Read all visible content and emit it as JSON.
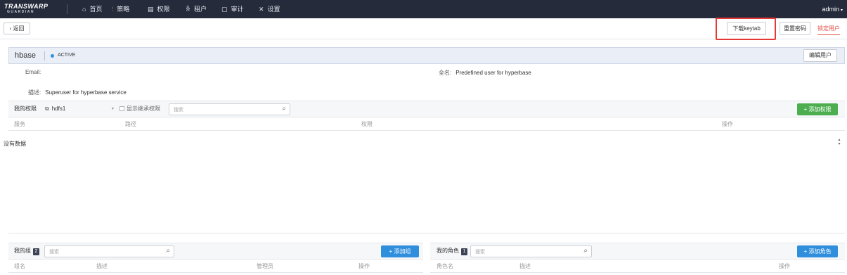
{
  "navbar": {
    "logo_line1": "TRANSWARP",
    "logo_line2": "GUARDIAN",
    "items": [
      {
        "label": "首页",
        "icon": "home-icon"
      },
      {
        "label": "策略",
        "icon": "sliders-icon"
      },
      {
        "label": "权限",
        "icon": "server-icon"
      },
      {
        "label": "租户",
        "icon": "users-icon"
      },
      {
        "label": "审计",
        "icon": "document-icon"
      },
      {
        "label": "设置",
        "icon": "tools-icon"
      }
    ],
    "user": "admin"
  },
  "toolbar": {
    "back_label": "返回",
    "download_keytab_label": "下载keytab",
    "reset_password_label": "重置密码",
    "lock_user_label": "锁定用户"
  },
  "user": {
    "name": "hbase",
    "status": "ACTIVE",
    "status_color": "#2f8fdd",
    "edit_label": "编辑用户",
    "email_label": "Email:",
    "email_value": "",
    "fullname_label": "全名:",
    "fullname_value": "Predefined user for hyperbase",
    "desc_label": "描述:",
    "desc_value": "Superuser for hyperbase service"
  },
  "permissions": {
    "title": "我的权限",
    "selected_service": "hdfs1",
    "show_inherited_label": "显示继承权限",
    "search_placeholder": "搜索",
    "add_label": "+ 添加权限",
    "columns": [
      "服务",
      "路径",
      "权限",
      "操作"
    ],
    "empty_text": "没有数据"
  },
  "groups": {
    "title": "我的组",
    "count": "2",
    "search_placeholder": "搜索",
    "add_label": "+ 添加组",
    "columns": [
      "组名",
      "描述",
      "管理员",
      "操作"
    ]
  },
  "roles": {
    "title": "我的角色",
    "count": "1",
    "search_placeholder": "搜索",
    "add_label": "+ 添加角色",
    "columns": [
      "角色名",
      "描述",
      "操作"
    ]
  },
  "colors": {
    "navbar_bg": "#262b3b",
    "accent_red": "#e25049",
    "add_green": "#4cae4f",
    "add_blue": "#2f8fdd",
    "highlight_red": "#e53935"
  }
}
